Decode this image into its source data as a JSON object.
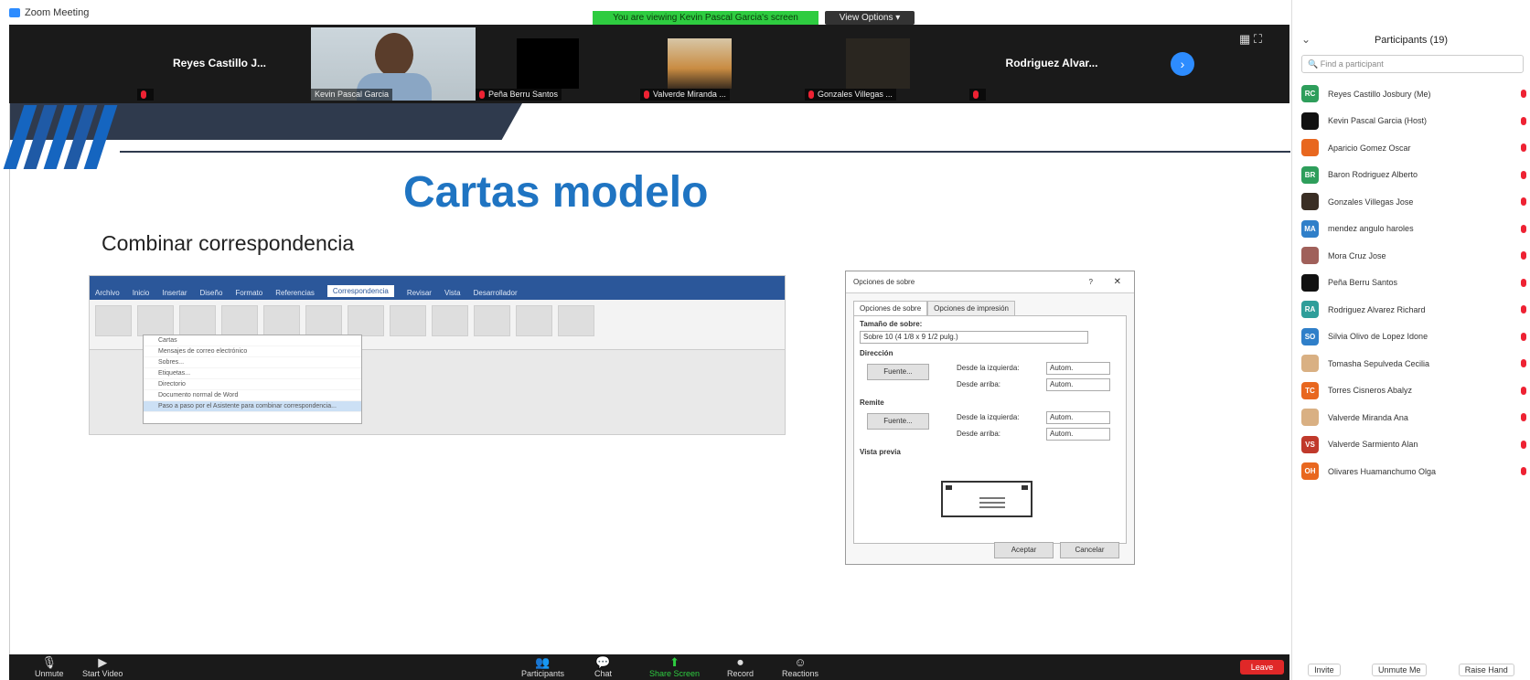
{
  "window": {
    "title": "Zoom Meeting",
    "controls": [
      "–",
      "❐",
      "✕"
    ]
  },
  "share_banner": "You are viewing Kevin Pascal Garcia's screen",
  "view_options": "View Options ▾",
  "video_strip": {
    "tiles": [
      {
        "name": "Reyes Castillo J...",
        "caption": ""
      },
      {
        "name": "",
        "caption": "Kevin Pascal Garcia"
      },
      {
        "name": "",
        "caption": "Peña Berru Santos"
      },
      {
        "name": "",
        "caption": "Valverde Miranda ..."
      },
      {
        "name": "",
        "caption": "Gonzales Villegas ..."
      },
      {
        "name": "Rodriguez Alvar...",
        "caption": ""
      }
    ],
    "next_icon": "›"
  },
  "slide": {
    "title": "Cartas modelo",
    "subtitle": "Combinar correspondencia",
    "word_tabs": [
      "Archivo",
      "Inicio",
      "Insertar",
      "Diseño",
      "Formato",
      "Referencias",
      "Correspondencia",
      "Revisar",
      "Vista",
      "Desarrollador"
    ],
    "word_active_tab": "Correspondencia",
    "word_menu": [
      "Cartas",
      "Mensajes de correo electrónico",
      "Sobres...",
      "Etiquetas...",
      "Directorio",
      "Documento normal de Word",
      "Paso a paso por el Asistente para combinar correspondencia..."
    ]
  },
  "dialog": {
    "title": "Opciones de sobre",
    "help": "?",
    "close": "✕",
    "tab1": "Opciones de sobre",
    "tab2": "Opciones de impresión",
    "size_label": "Tamaño de sobre:",
    "size_value": "Sobre 10      (4 1/8 x 9 1/2 pulg.)",
    "address_label": "Dirección",
    "return_label": "Remite",
    "font_button": "Fuente...",
    "from_left": "Desde la izquierda:",
    "from_top": "Desde arriba:",
    "auto": "Autom.",
    "preview_label": "Vista previa",
    "accept": "Aceptar",
    "cancel": "Cancelar"
  },
  "participants": {
    "header": "Participants (19)",
    "search_placeholder": "Find a participant",
    "people": [
      {
        "initials": "RC",
        "color": "#2e9e5b",
        "name": "Reyes Castillo Josbury (Me)"
      },
      {
        "initials": "",
        "color": "#111111",
        "name": "Kevin Pascal Garcia (Host)"
      },
      {
        "initials": "",
        "color": "#e8671f",
        "name": "Aparicio Gomez Oscar"
      },
      {
        "initials": "BR",
        "color": "#2e9e5b",
        "name": "Baron Rodriguez Alberto"
      },
      {
        "initials": "",
        "color": "#3a2e24",
        "name": "Gonzales Villegas Jose"
      },
      {
        "initials": "MA",
        "color": "#2f7fc9",
        "name": "mendez angulo haroles"
      },
      {
        "initials": "",
        "color": "#a0605a",
        "name": "Mora Cruz Jose"
      },
      {
        "initials": "",
        "color": "#111111",
        "name": "Peña Berru Santos"
      },
      {
        "initials": "RA",
        "color": "#2e9e9a",
        "name": "Rodriguez Alvarez Richard"
      },
      {
        "initials": "SO",
        "color": "#2f7fc9",
        "name": "Silvia Olivo de Lopez Idone"
      },
      {
        "initials": "",
        "color": "#d9b083",
        "name": "Tomasha Sepulveda Cecilia"
      },
      {
        "initials": "TC",
        "color": "#e8671f",
        "name": "Torres Cisneros Abalyz"
      },
      {
        "initials": "",
        "color": "#d9b083",
        "name": "Valverde Miranda Ana"
      },
      {
        "initials": "VS",
        "color": "#c0392b",
        "name": "Valverde Sarmiento Alan"
      },
      {
        "initials": "OH",
        "color": "#e8671f",
        "name": "Olivares Huamanchumo Olga"
      }
    ],
    "invite": "Invite",
    "unmute_me": "Unmute Me",
    "raise_hand": "Raise Hand"
  },
  "toolbar": {
    "unmute": "Unmute",
    "start_video": "Start Video",
    "participants": "Participants",
    "chat": "Chat",
    "share": "Share Screen",
    "record": "Record",
    "reactions": "Reactions",
    "leave": "Leave"
  }
}
